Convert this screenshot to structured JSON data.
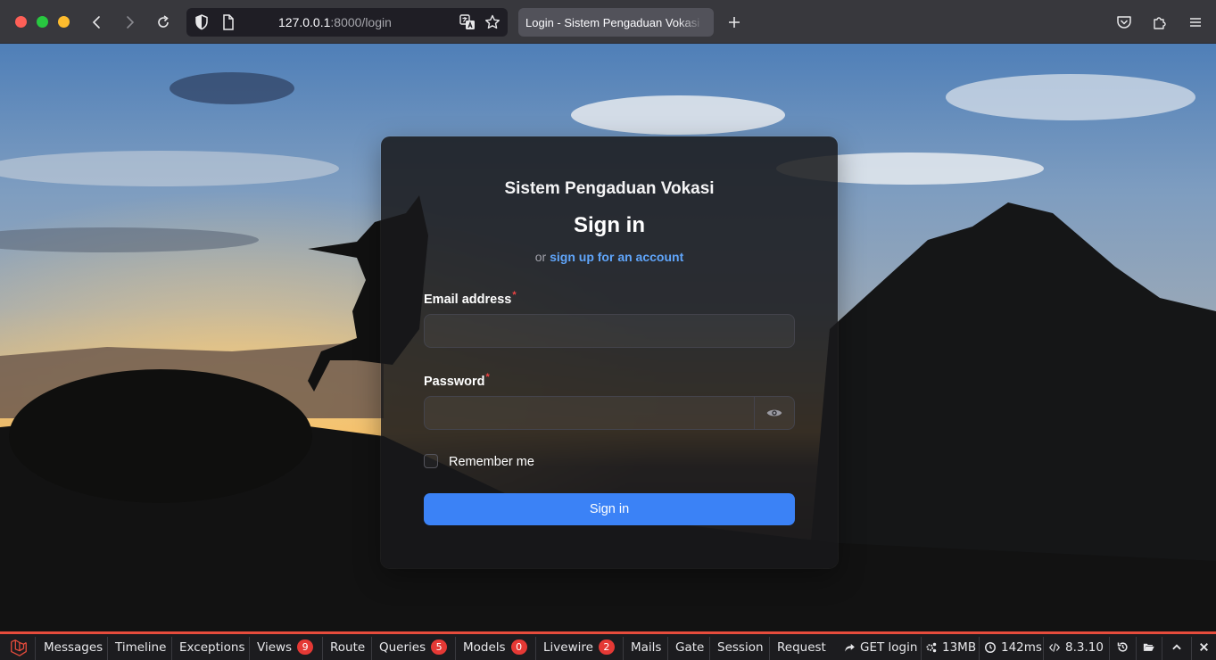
{
  "browser": {
    "url_host": "127.0.0.1",
    "url_path": ":8000/login",
    "tab_title": "Login - Sistem Pengaduan Vokasi"
  },
  "login": {
    "brand": "Sistem Pengaduan Vokasi",
    "heading": "Sign in",
    "or_text": "or",
    "signup_link": "sign up for an account",
    "email_label": "Email address",
    "email_value": "",
    "password_label": "Password",
    "password_value": "",
    "required_mark": "*",
    "remember_label": "Remember me",
    "remember_checked": false,
    "submit_label": "Sign in",
    "accent_color": "#3b82f6",
    "link_color": "#60a5fa"
  },
  "debugbar": {
    "accent_color": "#e74c3c",
    "tabs": [
      {
        "label": "Messages"
      },
      {
        "label": "Timeline"
      },
      {
        "label": "Exceptions"
      },
      {
        "label": "Views",
        "badge": "9"
      },
      {
        "label": "Route"
      },
      {
        "label": "Queries",
        "badge": "5"
      },
      {
        "label": "Models",
        "badge": "0"
      },
      {
        "label": "Livewire",
        "badge": "2"
      },
      {
        "label": "Mails"
      },
      {
        "label": "Gate"
      },
      {
        "label": "Session"
      },
      {
        "label": "Request"
      }
    ],
    "request": "GET login",
    "memory": "13MB",
    "duration": "142ms",
    "php_version": "8.3.10"
  }
}
